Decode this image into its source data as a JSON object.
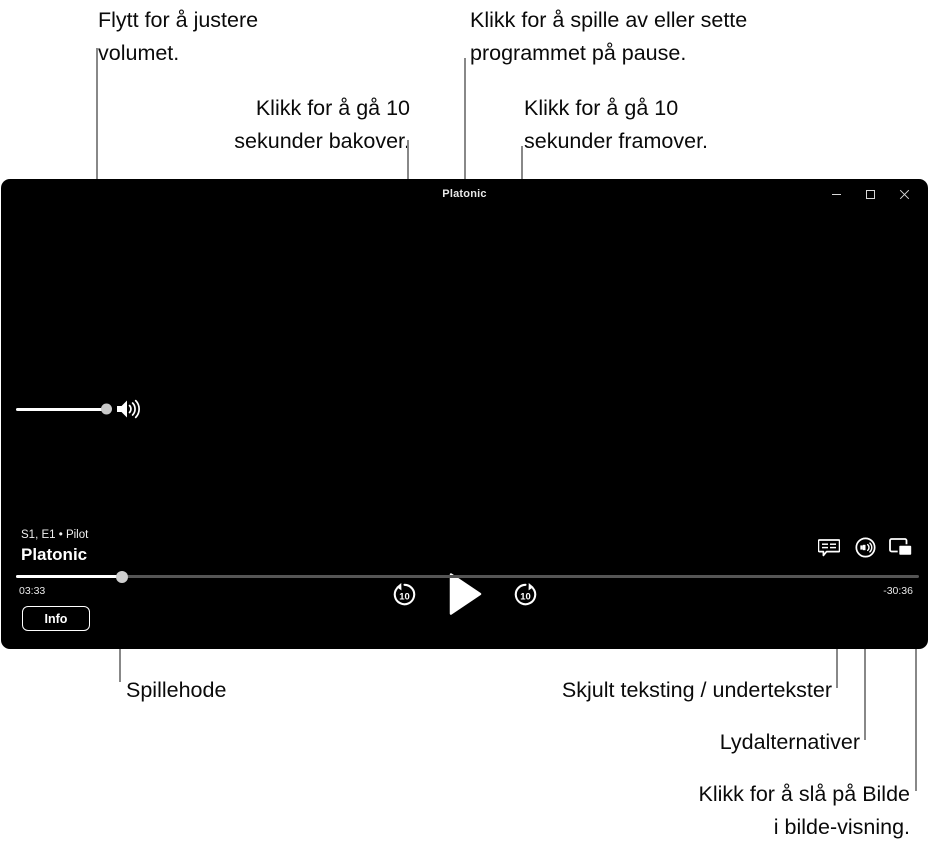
{
  "callouts": {
    "volume": "Flytt for å justere\nvolumet.",
    "playpause": "Klikk for å spille av eller sette\nprogrammet på pause.",
    "back10": "Klikk for å gå 10\nsekunder bakover.",
    "forward10": "Klikk for å gå 10\nsekunder framover.",
    "playhead": "Spillehode",
    "captions": "Skjult teksting / undertekster",
    "audio_options": "Lydalternativer",
    "pip": "Klikk for å slå på Bilde\ni bilde-visning."
  },
  "player": {
    "window_title": "Platonic",
    "window_controls": [
      {
        "name": "minimize",
        "glyph": "minimize-icon"
      },
      {
        "name": "maximize",
        "glyph": "maximize-icon"
      },
      {
        "name": "close",
        "glyph": "close-icon"
      }
    ],
    "volume": {
      "icon": "speaker-wave-icon",
      "level_percent": 100
    },
    "transport": [
      {
        "name": "skip-back-10",
        "icon": "skip-back-10-icon",
        "label": "10"
      },
      {
        "name": "play",
        "icon": "play-icon"
      },
      {
        "name": "skip-forward-10",
        "icon": "skip-forward-10-icon",
        "label": "10"
      }
    ],
    "now_playing": {
      "subtitle": "S1, E1 • Pilot",
      "title": "Platonic"
    },
    "progress": {
      "elapsed": "03:33",
      "remaining": "-30:36",
      "percent": 11.7
    },
    "info_button": "Info",
    "right_controls": [
      {
        "name": "closed-captions",
        "icon": "closed-captions-icon"
      },
      {
        "name": "audio-options",
        "icon": "audio-options-icon"
      },
      {
        "name": "picture-in-picture",
        "icon": "picture-in-picture-icon"
      }
    ]
  },
  "colors": {
    "page_background": "#ffffff",
    "player_background": "#000000",
    "leader_line": "#888888",
    "accent_white": "#ffffff",
    "track_inactive": "#555555"
  }
}
